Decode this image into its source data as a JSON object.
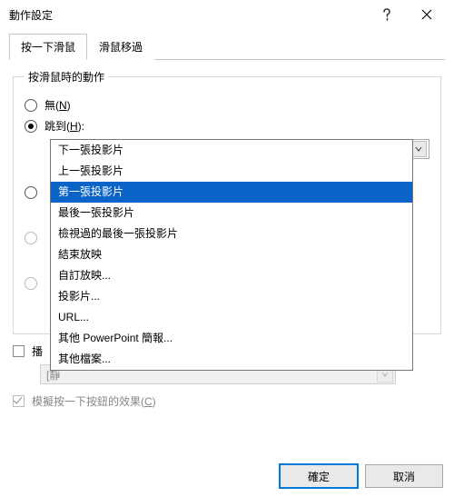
{
  "title": "動作設定",
  "tabs": {
    "click": "按一下滑鼠",
    "hover": "滑鼠移過"
  },
  "group": {
    "legend": "按滑鼠時的動作",
    "radios": {
      "none": "無(N)",
      "hyperlink": "跳到(H):"
    },
    "combo": {
      "selected": "第一張投影片",
      "options": [
        "下一張投影片",
        "上一張投影片",
        "第一張投影片",
        "最後一張投影片",
        "檢視過的最後一張投影片",
        "結束放映",
        "自訂放映...",
        "投影片...",
        "URL...",
        "其他 PowerPoint 簡報...",
        "其他檔案..."
      ]
    },
    "play_sound": "播",
    "sound_combo": "[靜",
    "simulate": "模擬按一下按鈕的效果(C)"
  },
  "buttons": {
    "ok": "確定",
    "cancel": "取消"
  }
}
